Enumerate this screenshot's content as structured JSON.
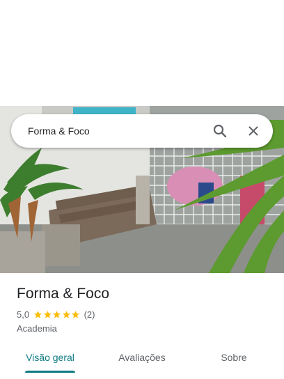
{
  "search": {
    "query": "Forma & Foco",
    "search_icon": "search-icon",
    "close_icon": "close-icon"
  },
  "place": {
    "name": "Forma & Foco",
    "rating": "5,0",
    "stars": 5,
    "review_count": "(2)",
    "category": "Academia"
  },
  "tabs": [
    {
      "label": "Visão geral",
      "active": true
    },
    {
      "label": "Avaliações",
      "active": false
    },
    {
      "label": "Sobre",
      "active": false
    }
  ],
  "colors": {
    "accent": "#0b7a82",
    "star": "#fbbc04",
    "text": "#202124",
    "secondary": "#5f6368"
  }
}
